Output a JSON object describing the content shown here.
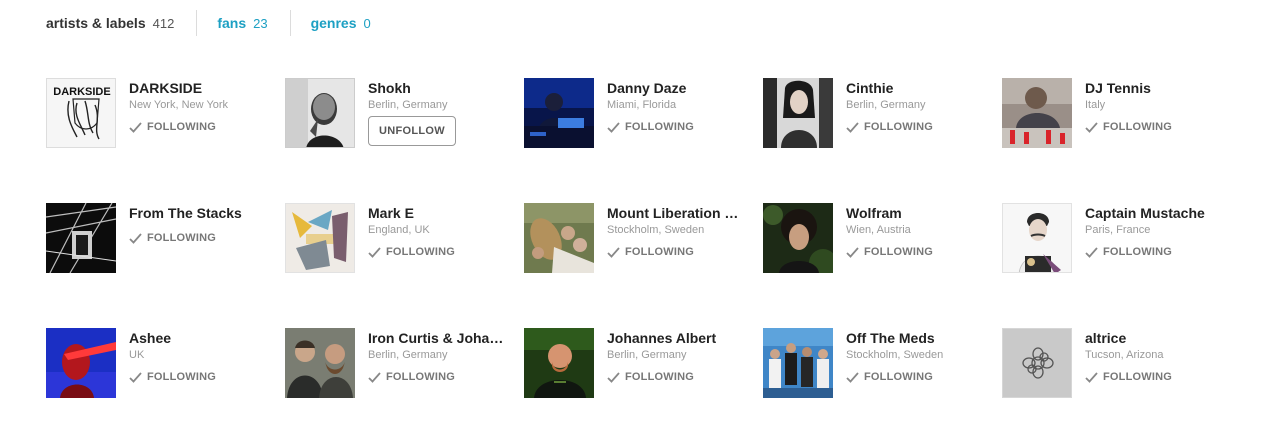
{
  "tabs": [
    {
      "label": "artists & labels",
      "count": "412"
    },
    {
      "label": "fans",
      "count": "23"
    },
    {
      "label": "genres",
      "count": "0"
    }
  ],
  "follow_label": "FOLLOWING",
  "unfollow_label": "UNFOLLOW",
  "cards": [
    {
      "name": "DARKSIDE",
      "location": "New York, New York",
      "status": "FOLLOWING"
    },
    {
      "name": "Shokh",
      "location": "Berlin, Germany",
      "status": "UNFOLLOW"
    },
    {
      "name": "Danny Daze",
      "location": "Miami, Florida",
      "status": "FOLLOWING"
    },
    {
      "name": "Cinthie",
      "location": "Berlin, Germany",
      "status": "FOLLOWING"
    },
    {
      "name": "DJ Tennis",
      "location": "Italy",
      "status": "FOLLOWING"
    },
    {
      "name": "From The Stacks",
      "location": "",
      "status": "FOLLOWING"
    },
    {
      "name": "Mark E",
      "location": "England, UK",
      "status": "FOLLOWING"
    },
    {
      "name": "Mount Liberation …",
      "location": "Stockholm, Sweden",
      "status": "FOLLOWING"
    },
    {
      "name": "Wolfram",
      "location": "Wien, Austria",
      "status": "FOLLOWING"
    },
    {
      "name": "Captain Mustache",
      "location": "Paris, France",
      "status": "FOLLOWING"
    },
    {
      "name": "Ashee",
      "location": "UK",
      "status": "FOLLOWING"
    },
    {
      "name": "Iron Curtis & Joha…",
      "location": "Berlin, Germany",
      "status": "FOLLOWING"
    },
    {
      "name": "Johannes Albert",
      "location": "Berlin, Germany",
      "status": "FOLLOWING"
    },
    {
      "name": "Off The Meds",
      "location": "Stockholm, Sweden",
      "status": "FOLLOWING"
    },
    {
      "name": "altrice",
      "location": "Tucson, Arizona",
      "status": "FOLLOWING"
    }
  ],
  "thumb_logo_text": "DARKSIDE",
  "colors": {
    "link": "#1da0c3",
    "text": "#222222",
    "muted": "#999999",
    "follow_text": "#777777"
  }
}
